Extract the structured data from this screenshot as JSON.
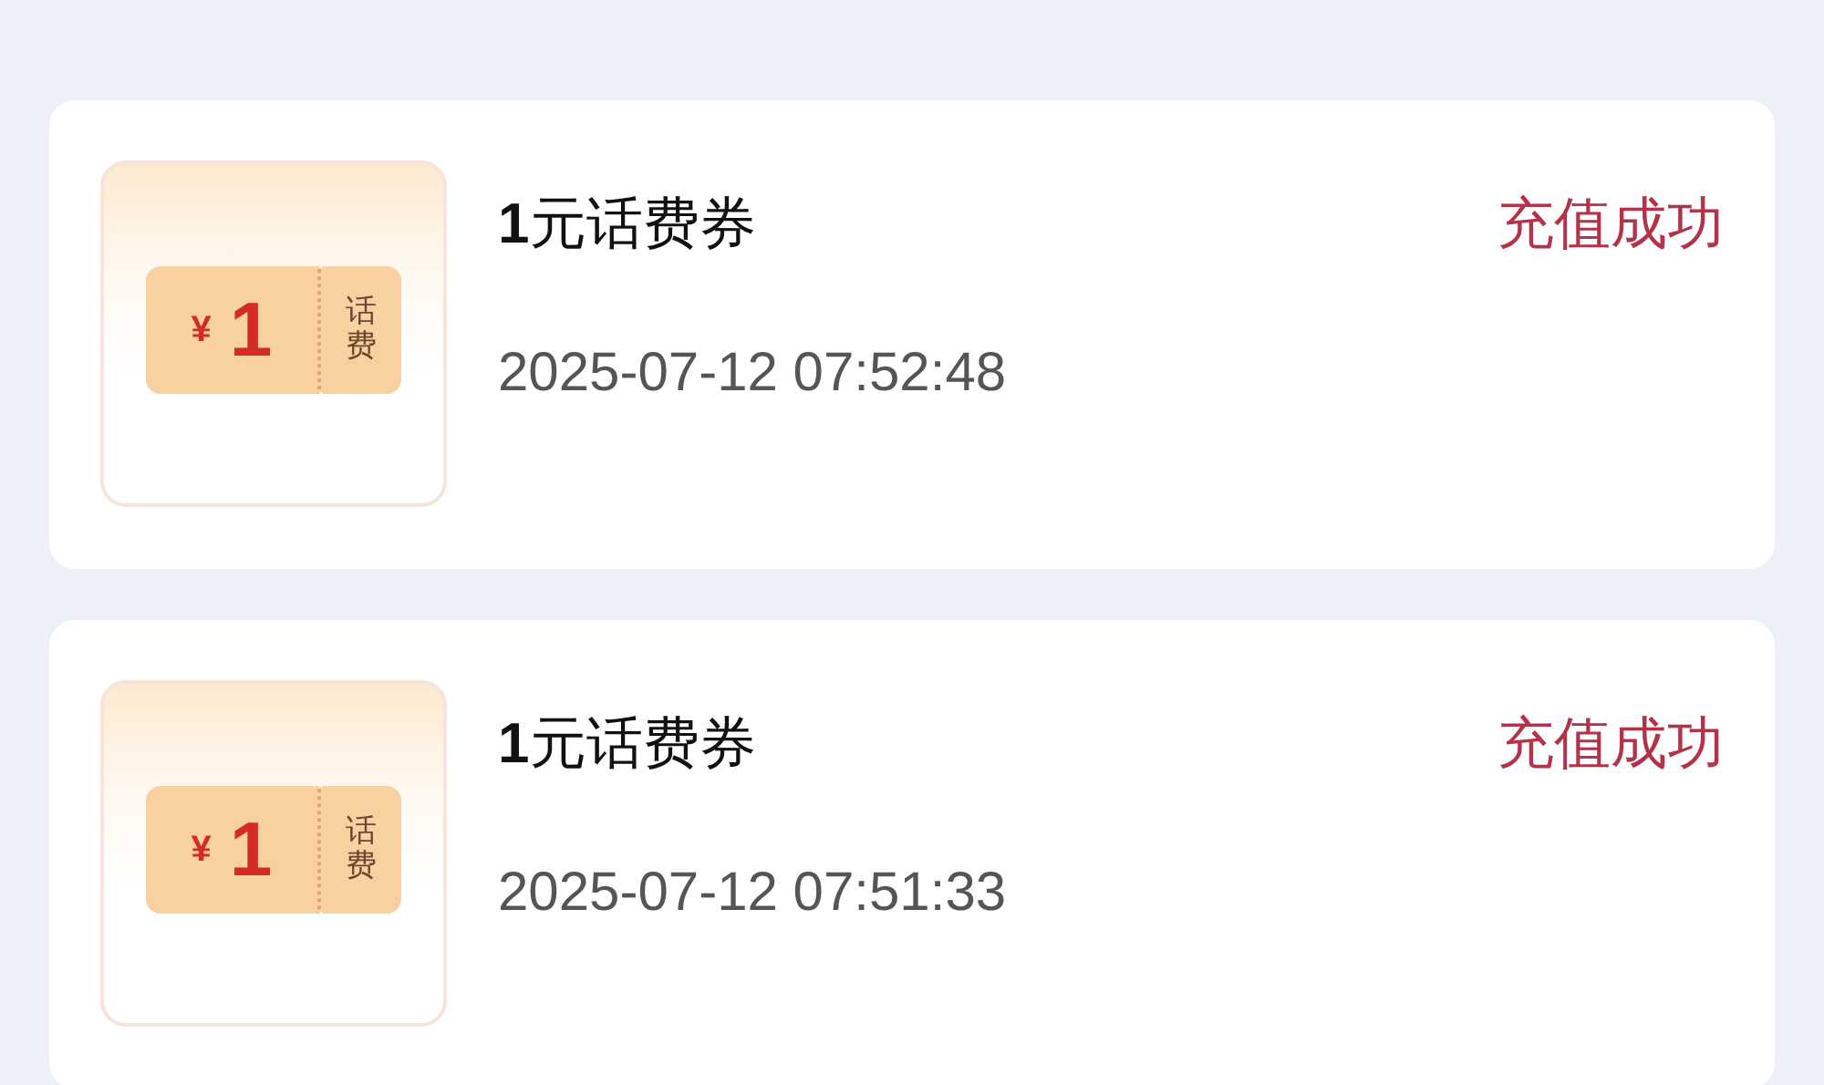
{
  "records": [
    {
      "coupon": {
        "currency": "¥",
        "amount": "1",
        "tag": "话费"
      },
      "title": "**1**元话费券",
      "status": "充值成功",
      "time": "2025-07-12 07:52:48"
    },
    {
      "coupon": {
        "currency": "¥",
        "amount": "1",
        "tag": "话费"
      },
      "title": "**1**元话费券",
      "status": "充值成功",
      "time": "2025-07-12 07:51:33"
    }
  ]
}
